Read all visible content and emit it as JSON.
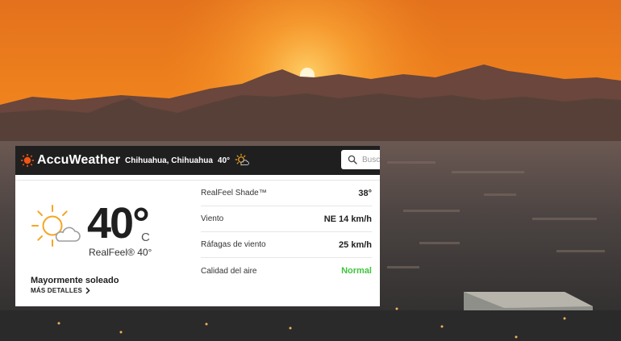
{
  "header": {
    "brand": "AccuWeather",
    "location": "Chihuahua, Chihuahua",
    "temp": "40°",
    "search_placeholder": "Busc"
  },
  "current": {
    "temperature": "40°",
    "unit": "C",
    "realfeel": "RealFeel® 40°",
    "condition": "Mayormente soleado",
    "more_details": "MÁS DETALLES"
  },
  "details": [
    {
      "label": "RealFeel Shade™",
      "value": "38°"
    },
    {
      "label": "Viento",
      "value": "NE 14 km/h"
    },
    {
      "label": "Ráfagas de viento",
      "value": "25 km/h"
    },
    {
      "label": "Calidad del aire",
      "value": "Normal"
    }
  ],
  "colors": {
    "brand_orange": "#f05514",
    "topbar": "#1f1f1f",
    "air_quality_good": "#3ec43e"
  },
  "icons": {
    "brand": "sun-logo-icon",
    "condition": "mostly-sunny-icon",
    "search": "search-icon"
  }
}
